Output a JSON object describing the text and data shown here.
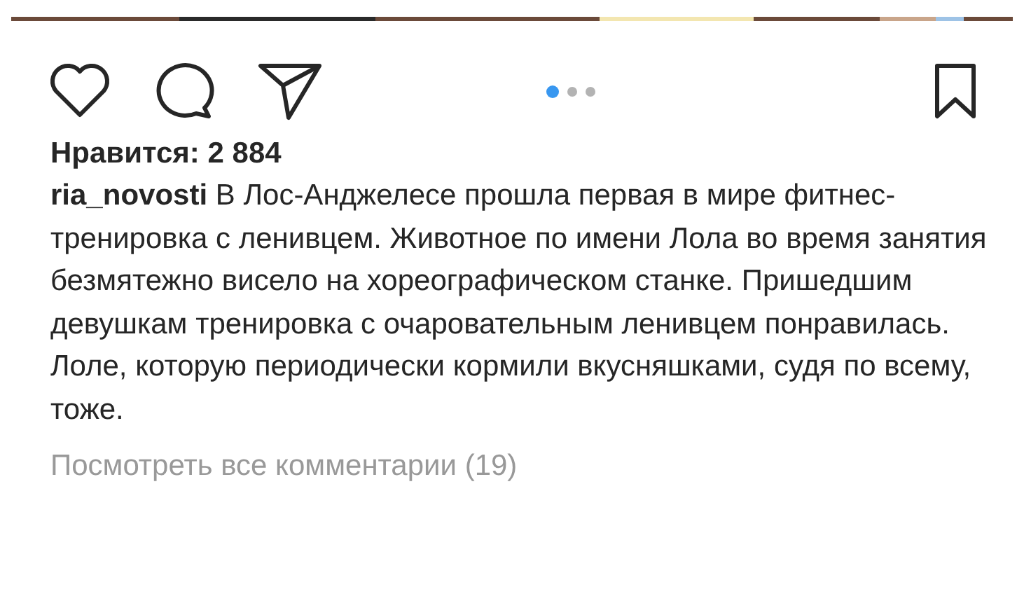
{
  "post": {
    "carousel_dots": [
      {
        "selected": true
      },
      {
        "selected": false
      },
      {
        "selected": false
      }
    ],
    "likes": "Нравится: 2 884",
    "username": "ria_novosti",
    "caption": "В Лос-Анджелесе прошла первая в мире фитнес-тренировка с ленивцем. Животное по имени Лола во время занятия безмятежно висело на хореографическом станке. Пришедшим девушкам тренировка с очаровательным ленивцем понравилась. Лоле, которую периодически кормили вкусняшками, судя по всему, тоже.",
    "view_comments": "Посмотреть все комментарии (19)"
  }
}
